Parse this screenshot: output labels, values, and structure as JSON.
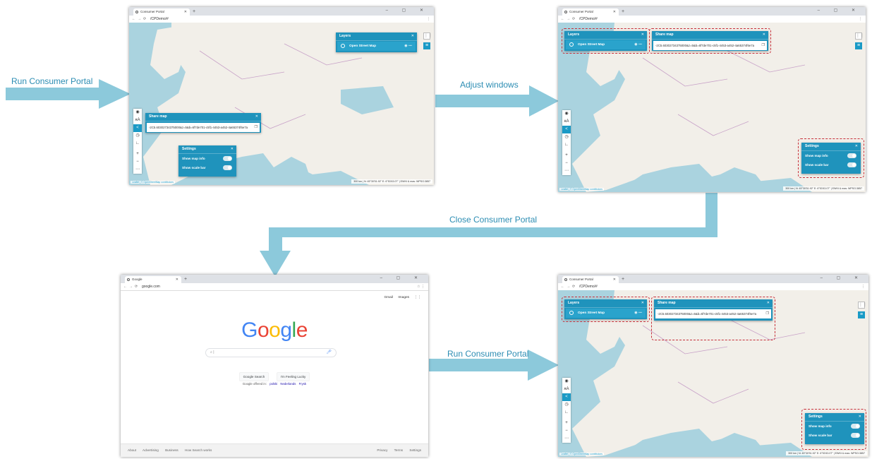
{
  "flow": {
    "step1": "Run Consumer Portal",
    "step2": "Adjust windows",
    "step3": "Close Consumer Portal",
    "step4": "Run Consumer Portal"
  },
  "colors": {
    "arrow": "#8cc9db",
    "panel": "#1f93bc",
    "dashed_highlight": "#c7303a",
    "sea": "#aad3df",
    "land": "#f2efe9"
  },
  "portal": {
    "tab_title": "Consumer Portal",
    "url": "/CPDemo/#",
    "window_controls": "–  ▢  ✕",
    "layers": {
      "title": "Layers",
      "item": "Open Street Map"
    },
    "share": {
      "title": "Share map",
      "link": "-2C5.60302734375000&z=5&b=6f7de701-c5f1-4453-a452-4a65374f6e7a"
    },
    "settings": {
      "title": "Settings",
      "map_info": "Show map info",
      "scale_bar": "Show scale bar"
    },
    "scale": {
      "dist": "300 km",
      "lat": "N: 45°30'51.92\"",
      "lon": "E: 6°53'43.07\"",
      "crs": "EWKt & mas: WPSG:3857"
    },
    "attribution": "Leaflet | © OpenStreetMap contributors"
  },
  "google": {
    "tab_title": "Google",
    "url": "google.com",
    "logo": [
      "G",
      "o",
      "o",
      "g",
      "l",
      "e"
    ],
    "logo_colors": [
      "#4285f4",
      "#ea4335",
      "#fbbc05",
      "#4285f4",
      "#34a853",
      "#ea4335"
    ],
    "top_links": {
      "gmail": "Gmail",
      "images": "Images"
    },
    "search_cursor": "|",
    "btn_search": "Google Search",
    "btn_lucky": "I'm Feeling Lucky",
    "offered_in": "Google offered in:",
    "languages": [
      "polski",
      "Nederlands",
      "Frysk"
    ],
    "footer_left": [
      "About",
      "Advertising",
      "Business",
      "How Search works"
    ],
    "footer_right": [
      "Privacy",
      "Terms",
      "Settings"
    ]
  }
}
